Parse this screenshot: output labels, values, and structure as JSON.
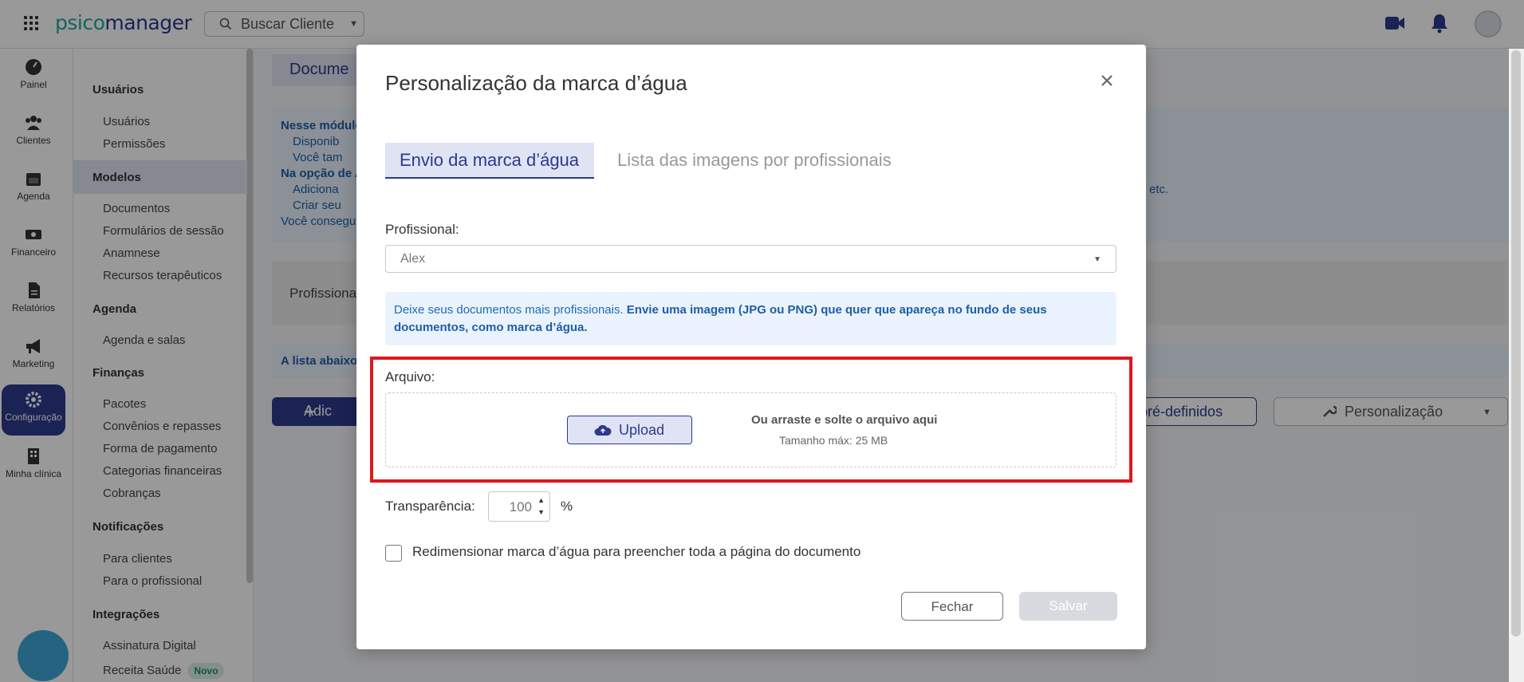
{
  "app": {
    "logo_part1": "psico",
    "logo_part2": "manager"
  },
  "search": {
    "label": "Buscar Cliente"
  },
  "rail": [
    {
      "label": "Painel",
      "icon": "gauge-icon"
    },
    {
      "label": "Clientes",
      "icon": "users-icon"
    },
    {
      "label": "Agenda",
      "icon": "calendar-icon"
    },
    {
      "label": "Financeiro",
      "icon": "money-icon"
    },
    {
      "label": "Relatórios",
      "icon": "file-icon"
    },
    {
      "label": "Marketing",
      "icon": "megaphone-icon"
    },
    {
      "label": "Configuração",
      "icon": "gear-icon",
      "active": true
    },
    {
      "label": "Minha clínica",
      "icon": "building-icon"
    }
  ],
  "settings": {
    "usuarios": {
      "title": "Usuários",
      "items": [
        "Usuários",
        "Permissões"
      ]
    },
    "modelos": {
      "title": "Modelos",
      "items": [
        "Documentos",
        "Formulários de sessão",
        "Anamnese",
        "Recursos terapêuticos"
      ]
    },
    "agenda": {
      "title": "Agenda",
      "items": [
        "Agenda e salas"
      ]
    },
    "financas": {
      "title": "Finanças",
      "items": [
        "Pacotes",
        "Convênios e repasses",
        "Forma de pagamento",
        "Categorias financeiras",
        "Cobranças"
      ]
    },
    "notificacoes": {
      "title": "Notificações",
      "items": [
        "Para clientes",
        "Para o profissional"
      ]
    },
    "integracoes": {
      "title": "Integrações",
      "items": [
        "Assinatura Digital",
        "Receita Saúde"
      ],
      "badge": "Novo"
    }
  },
  "background": {
    "title": "Docume",
    "info_lines": [
      "Nesse módulo",
      "Disponib",
      "Você tam",
      "Na opção de A",
      "Adiciona",
      "Criar seu",
      "Você consegu"
    ],
    "info_suffix": "etc.",
    "prof_label": "Profissiona",
    "list_text": "A lista abaixo",
    "add_label": "Adic",
    "predef_label": "pré-definidos",
    "pers_label": "Personalização"
  },
  "modal": {
    "title": "Personalização da marca d’água",
    "tabs": [
      "Envio da marca d’água",
      "Lista das imagens por profissionais"
    ],
    "profissional_label": "Profissional:",
    "profissional_value": "Alex",
    "note_normal": "Deixe seus documentos mais profissionais. ",
    "note_bold": "Envie uma imagem (JPG ou PNG) que quer que apareça no fundo de seus documentos, como marca d’água.",
    "arquivo_label": "Arquivo:",
    "upload_label": "Upload",
    "drop_text": "Ou arraste e solte o arquivo aqui",
    "drop_sub": "Tamanho máx: 25 MB",
    "transparencia_label": "Transparência:",
    "transparencia_value": "100",
    "pct": "%",
    "resize_label": "Redimensionar marca d’água para preencher toda a página do documento",
    "fechar": "Fechar",
    "salvar": "Salvar"
  },
  "colors": {
    "brand": "#2d3a8c",
    "accent": "#1fa999",
    "highlight": "#e0161e"
  }
}
